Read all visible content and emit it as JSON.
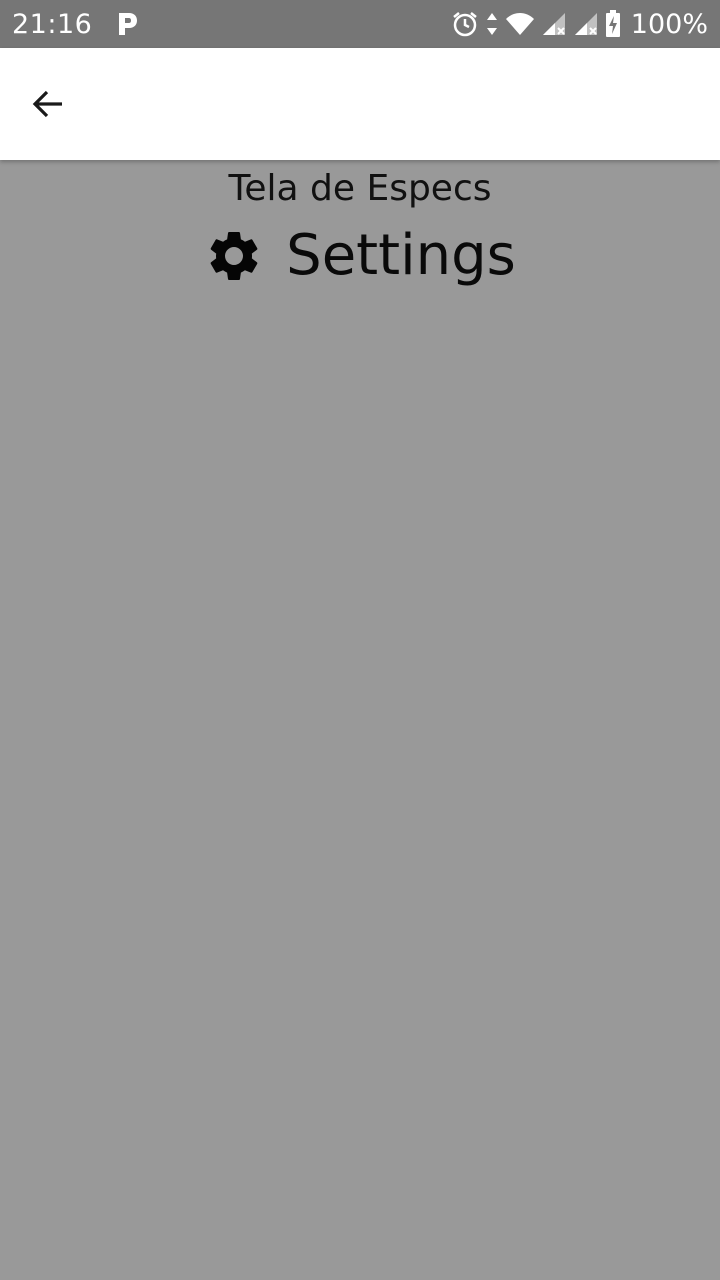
{
  "status_bar": {
    "time": "21:16",
    "battery": "100%",
    "icons": [
      "parking-icon",
      "alarm-icon",
      "data-arrows-icon",
      "wifi-icon",
      "signal-icon",
      "signal-icon",
      "battery-charging-icon"
    ]
  },
  "app_bar": {
    "back_icon": "back-arrow-icon"
  },
  "main": {
    "subtitle": "Tela de Especs",
    "settings_label": "Settings",
    "settings_icon": "gear-icon"
  },
  "colors": {
    "background": "#999999",
    "status_bar": "#767676",
    "app_bar": "#ffffff",
    "text": "#111111"
  }
}
